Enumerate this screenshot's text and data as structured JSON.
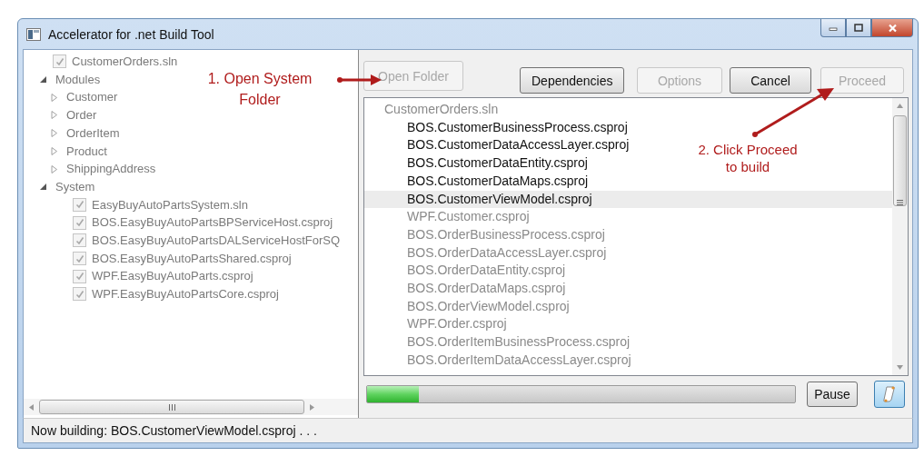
{
  "window": {
    "title": "Accelerator for .net Build Tool"
  },
  "tree": {
    "disabled": true,
    "items": [
      {
        "label": "CustomerOrders.sln",
        "checked": true
      },
      {
        "label": "Modules",
        "expanded": true,
        "children": [
          {
            "label": "Customer",
            "expanded": false
          },
          {
            "label": "Order",
            "expanded": false
          },
          {
            "label": "OrderItem",
            "expanded": false
          },
          {
            "label": "Product",
            "expanded": false
          },
          {
            "label": "ShippingAddress",
            "expanded": false
          }
        ]
      },
      {
        "label": "System",
        "expanded": true,
        "children": [
          {
            "label": "EasyBuyAutoPartsSystem.sln",
            "checked": true
          },
          {
            "label": "BOS.EasyBuyAutoPartsBPServiceHost.csproj",
            "checked": true
          },
          {
            "label": "BOS.EasyBuyAutoPartsDALServiceHostForSQ",
            "checked": true
          },
          {
            "label": "BOS.EasyBuyAutoPartsShared.csproj",
            "checked": true
          },
          {
            "label": "WPF.EasyBuyAutoParts.csproj",
            "checked": true
          },
          {
            "label": "WPF.EasyBuyAutoPartsCore.csproj",
            "checked": true
          }
        ]
      }
    ]
  },
  "toolbar": [
    {
      "label": "Open Folder",
      "disabled": true
    },
    {
      "label": "Dependencies",
      "disabled": false
    },
    {
      "label": "Options",
      "disabled": true
    },
    {
      "label": "Cancel",
      "disabled": false
    },
    {
      "label": "Proceed",
      "disabled": true
    }
  ],
  "build_list": [
    {
      "label": "CustomerOrders.sln",
      "built": false,
      "selected": false,
      "children": [
        {
          "label": "BOS.CustomerBusinessProcess.csproj",
          "built": true,
          "selected": false
        },
        {
          "label": "BOS.CustomerDataAccessLayer.csproj",
          "built": true,
          "selected": false
        },
        {
          "label": "BOS.CustomerDataEntity.csproj",
          "built": true,
          "selected": false
        },
        {
          "label": "BOS.CustomerDataMaps.csproj",
          "built": true,
          "selected": false
        },
        {
          "label": "BOS.CustomerViewModel.csproj",
          "built": true,
          "selected": true
        },
        {
          "label": "WPF.Customer.csproj",
          "built": false,
          "selected": false
        },
        {
          "label": "BOS.OrderBusinessProcess.csproj",
          "built": false,
          "selected": false
        },
        {
          "label": "BOS.OrderDataAccessLayer.csproj",
          "built": false,
          "selected": false
        },
        {
          "label": "BOS.OrderDataEntity.csproj",
          "built": false,
          "selected": false
        },
        {
          "label": "BOS.OrderDataMaps.csproj",
          "built": false,
          "selected": false
        },
        {
          "label": "BOS.OrderViewModel.csproj",
          "built": false,
          "selected": false
        },
        {
          "label": "WPF.Order.csproj",
          "built": false,
          "selected": false
        },
        {
          "label": "BOS.OrderItemBusinessProcess.csproj",
          "built": false,
          "selected": false
        },
        {
          "label": "BOS.OrderItemDataAccessLayer.csproj",
          "built": false,
          "selected": false
        }
      ]
    }
  ],
  "progress": {
    "level": 0.12
  },
  "pause_button": {
    "label": "Pause"
  },
  "scroll_toggle": {
    "on": true
  },
  "status_bar": "Now building: BOS.CustomerViewModel.csproj . . .",
  "annotations": [
    {
      "text": "1. Open System Folder"
    },
    {
      "text": "2. Click Proceed to build"
    }
  ]
}
